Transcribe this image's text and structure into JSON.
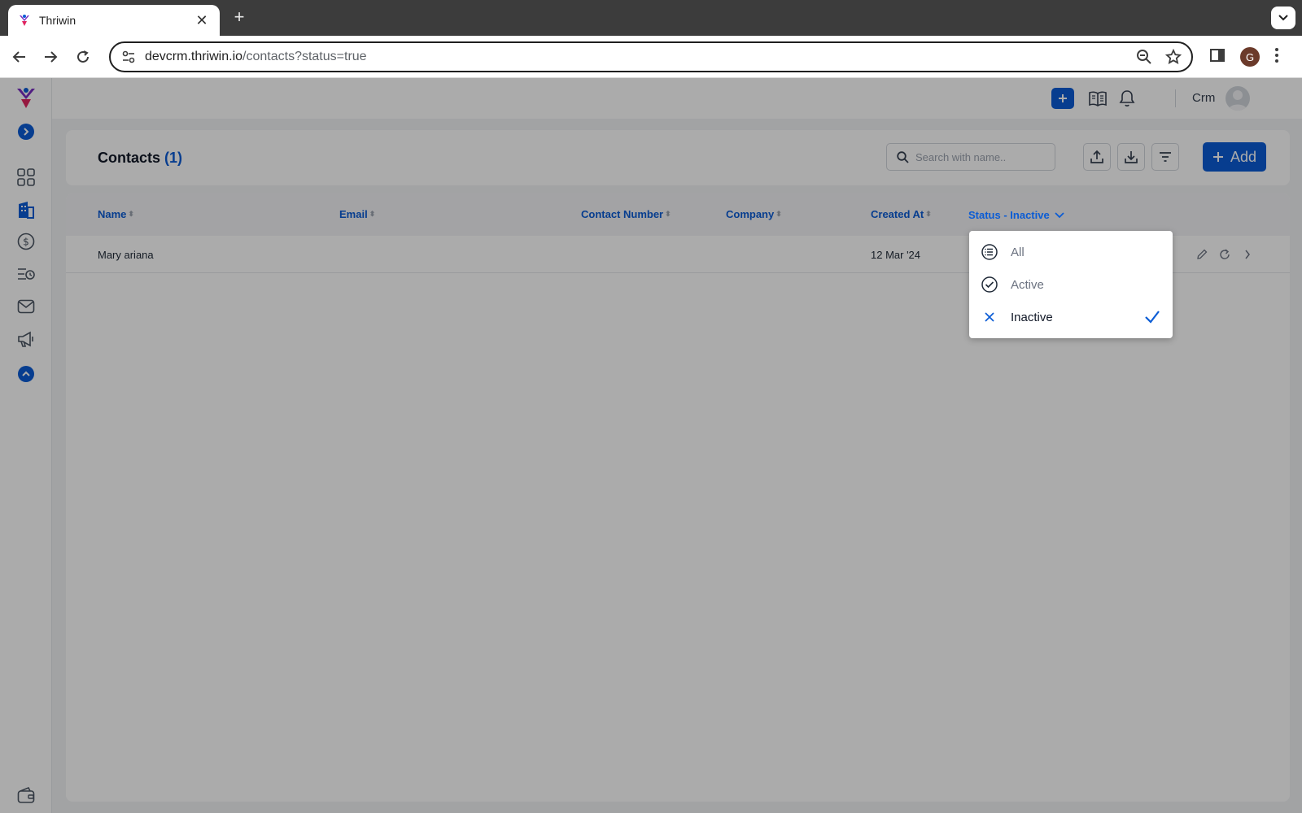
{
  "browser": {
    "tab_title": "Thriwin",
    "url_host": "devcrm.thriwin.io",
    "url_path": "/contacts?status=true",
    "profile_initial": "G"
  },
  "topbar": {
    "user_name": "Crm"
  },
  "contacts": {
    "title": "Contacts",
    "count": "(1)",
    "search_placeholder": "Search with name..",
    "add_label": "Add"
  },
  "table": {
    "columns": [
      "Name",
      "Email",
      "Contact Number",
      "Company",
      "Created At",
      "Status - Inactive"
    ],
    "rows": [
      {
        "name": "Mary ariana",
        "email": "",
        "contact_number": "",
        "company": "",
        "created_at": "12 Mar '24"
      }
    ]
  },
  "status_filter": {
    "options": [
      {
        "label": "All",
        "icon": "list-icon",
        "selected": false
      },
      {
        "label": "Active",
        "icon": "check-circle-icon",
        "selected": false
      },
      {
        "label": "Inactive",
        "icon": "x-icon",
        "selected": true
      }
    ]
  },
  "colors": {
    "accent": "#0b5cd5"
  }
}
